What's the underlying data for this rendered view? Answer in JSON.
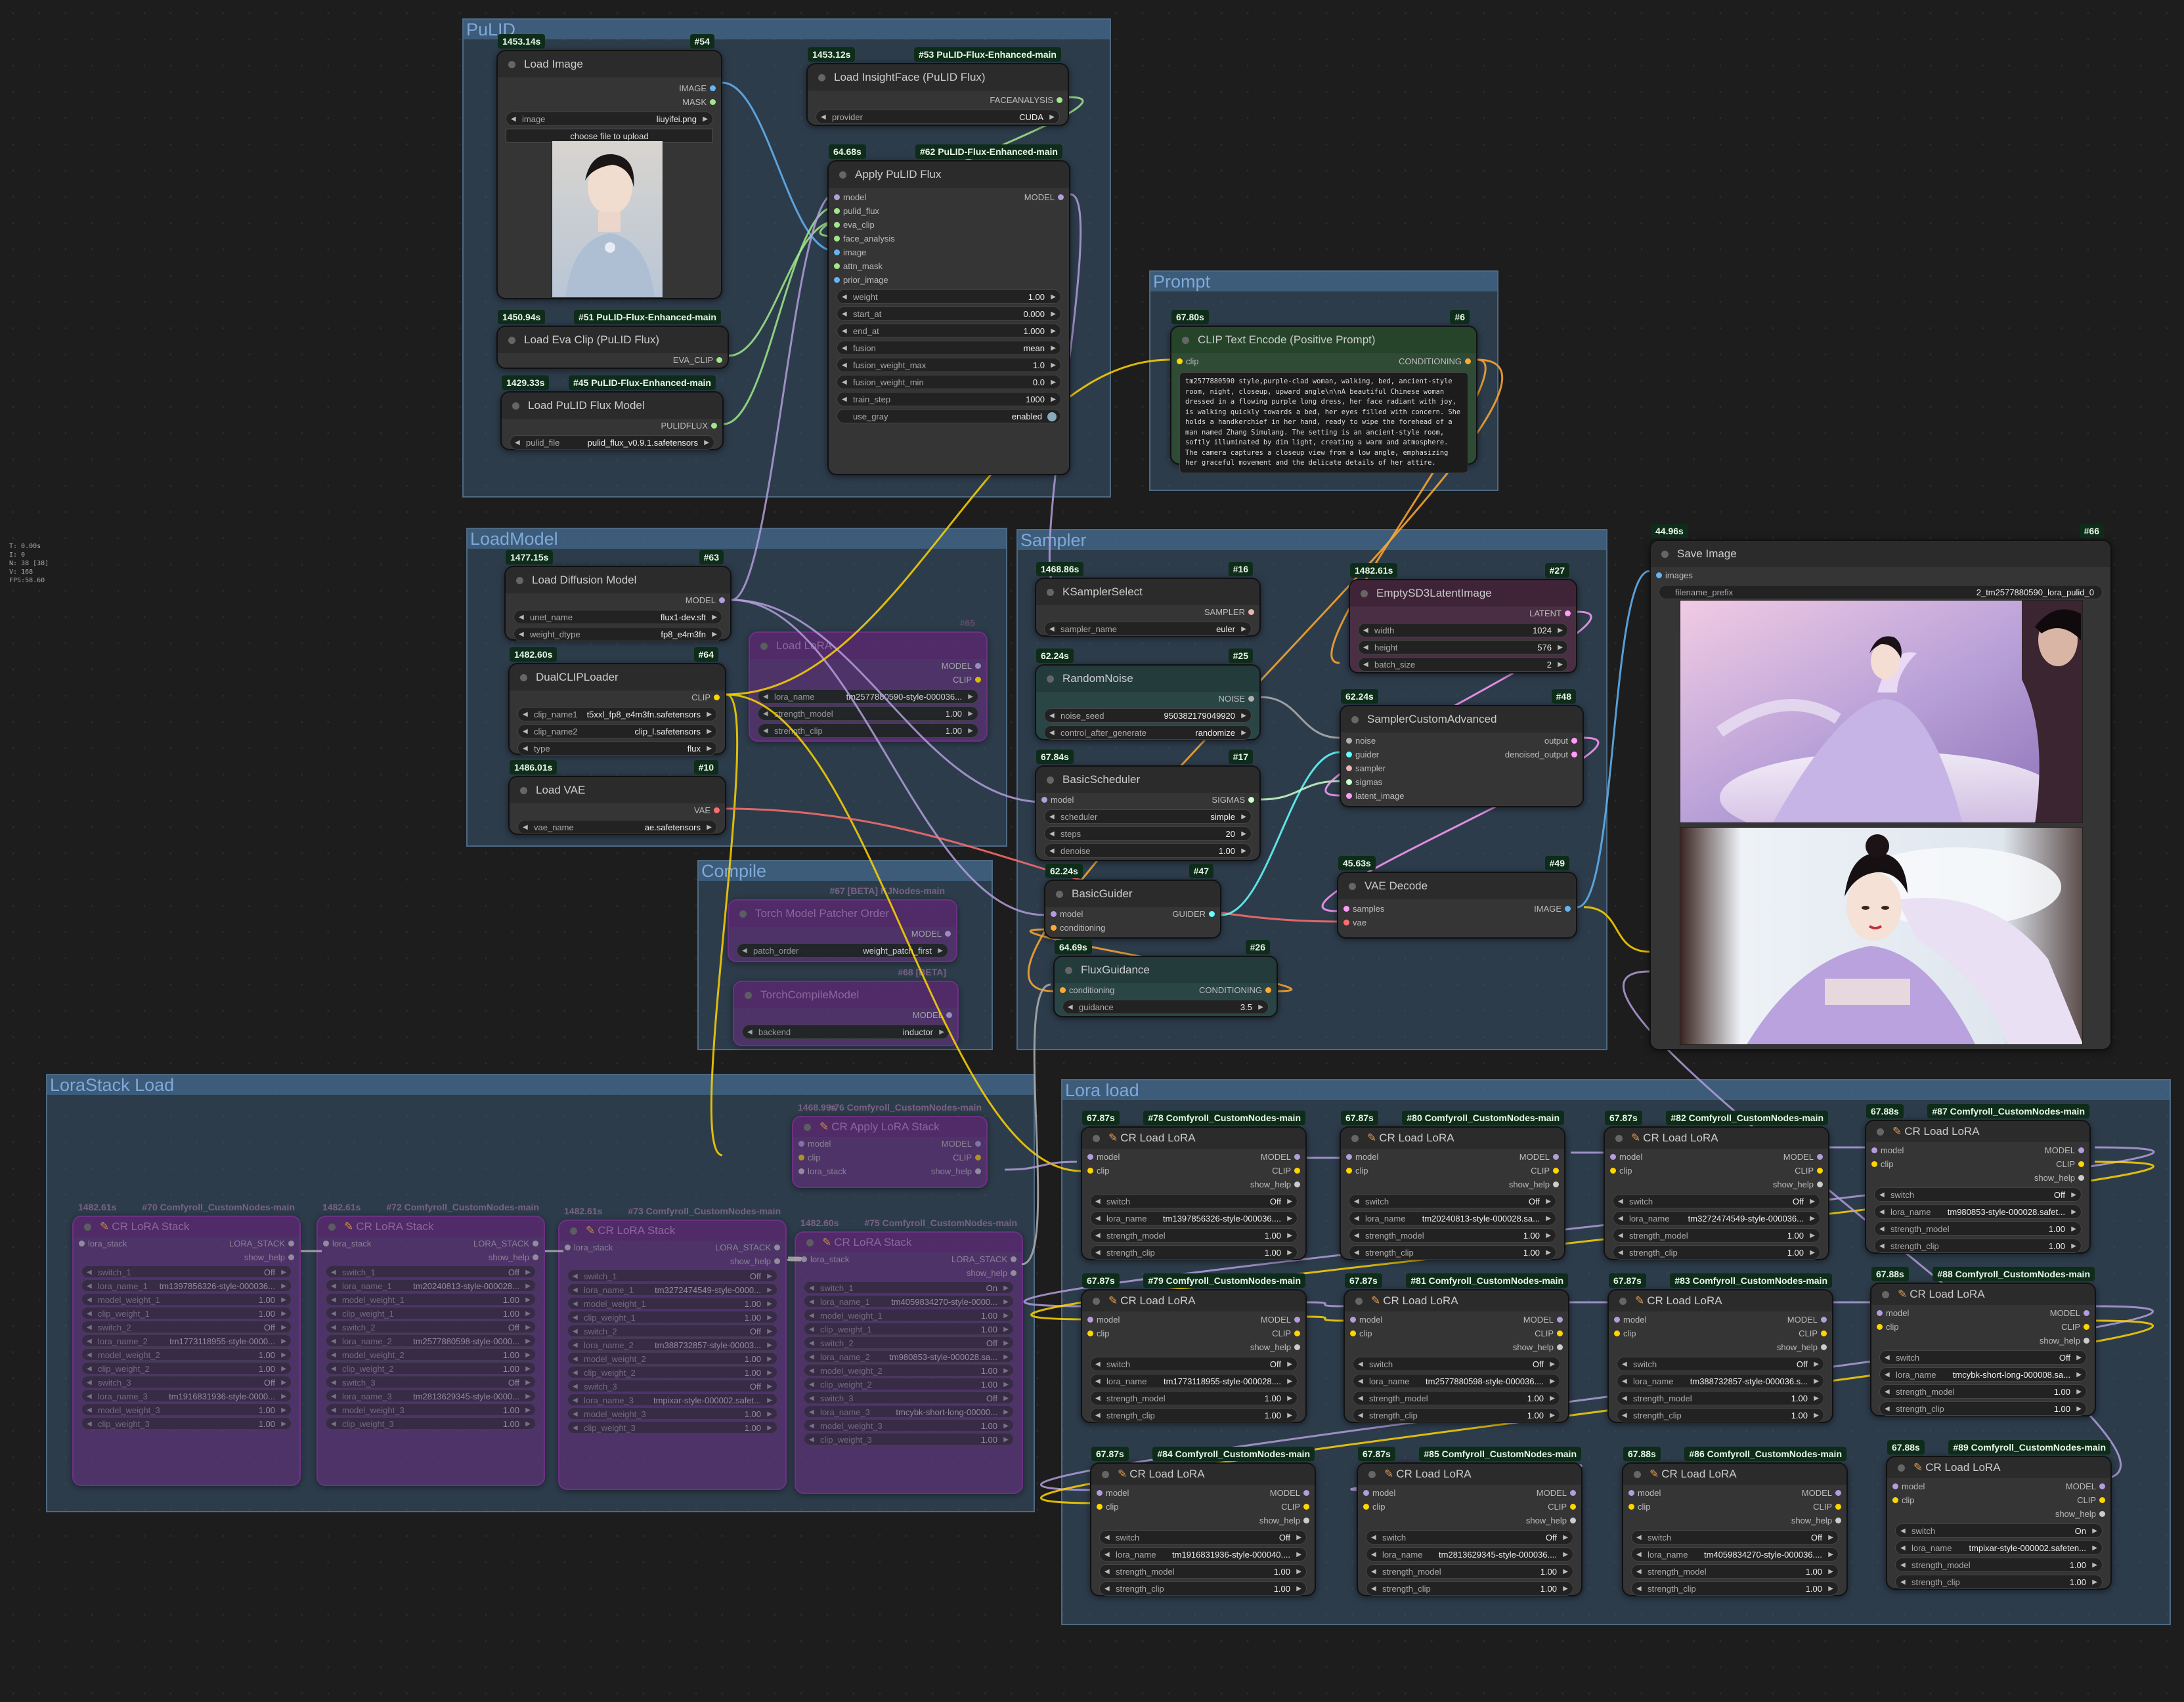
{
  "stats": {
    "line1": "T: 0.00s",
    "line2": "I: 0",
    "line3": "N: 38 [38]",
    "line4": "V: 168",
    "line5": "FPS:58.60"
  },
  "groups": {
    "pulid": "PuLID",
    "prompt": "Prompt",
    "loadmodel": "LoadModel",
    "sampler": "Sampler",
    "compile": "Compile",
    "lorastack": "LoraStack Load",
    "loraload": "Lora load"
  },
  "nodes": {
    "load_image": {
      "time": "1453.14s",
      "id": "#54",
      "title": "Load Image",
      "out1": "IMAGE",
      "out2": "MASK",
      "w_image_label": "image",
      "w_image_value": "liuyifei.png",
      "upload": "choose file to upload"
    },
    "insightface": {
      "time": "1453.12s",
      "id": "#53 PuLID-Flux-Enhanced-main",
      "title": "Load InsightFace (PuLID Flux)",
      "out1": "FACEANALYSIS",
      "w_label": "provider",
      "w_value": "CUDA"
    },
    "apply_pulid": {
      "time": "64.68s",
      "id": "#62 PuLID-Flux-Enhanced-main",
      "title": "Apply PuLID Flux",
      "in": [
        "model",
        "pulid_flux",
        "eva_clip",
        "face_analysis",
        "image",
        "attn_mask",
        "prior_image"
      ],
      "out1": "MODEL",
      "widgets": [
        [
          "weight",
          "1.00"
        ],
        [
          "start_at",
          "0.000"
        ],
        [
          "end_at",
          "1.000"
        ],
        [
          "fusion",
          "mean"
        ],
        [
          "fusion_weight_max",
          "1.0"
        ],
        [
          "fusion_weight_min",
          "0.0"
        ],
        [
          "train_step",
          "1000"
        ]
      ],
      "toggle_label": "use_gray",
      "toggle_value": "enabled"
    },
    "eva_clip": {
      "time": "1450.94s",
      "id": "#51 PuLID-Flux-Enhanced-main",
      "title": "Load Eva Clip (PuLID Flux)",
      "out1": "EVA_CLIP"
    },
    "pulid_model": {
      "time": "1429.33s",
      "id": "#45 PuLID-Flux-Enhanced-main",
      "title": "Load PuLID Flux Model",
      "out1": "PULIDFLUX",
      "w_label": "pulid_file",
      "w_value": "pulid_flux_v0.9.1.safetensors"
    },
    "clip_text": {
      "time": "67.80s",
      "id": "#6",
      "title": "CLIP Text Encode (Positive Prompt)",
      "in1": "clip",
      "out1": "CONDITIONING",
      "text": "tm2577880590 style,purple-clad woman, walking, bed, ancient-style room, night, closeup, upward angle\\n\\nA beautiful Chinese woman dressed in a flowing purple long dress, her face radiant with joy, is walking quickly towards a bed, her eyes filled with concern. She holds a handkerchief in her hand, ready to wipe the forehead of a man named Zhang Simulang. The setting is an ancient-style room, softly illuminated by dim light, creating a warm and atmosphere. The camera captures a closeup view from a low angle, emphasizing her graceful movement and the delicate details of her attire."
    },
    "load_diffusion": {
      "time": "1477.15s",
      "id": "#63",
      "title": "Load Diffusion Model",
      "out1": "MODEL",
      "widgets": [
        [
          "unet_name",
          "flux1-dev.sft"
        ],
        [
          "weight_dtype",
          "fp8_e4m3fn"
        ]
      ]
    },
    "dualclip": {
      "time": "1482.60s",
      "id": "#64",
      "title": "DualCLIPLoader",
      "out1": "CLIP",
      "widgets": [
        [
          "clip_name1",
          "t5xxl_fp8_e4m3fn.safetensors"
        ],
        [
          "clip_name2",
          "clip_l.safetensors"
        ],
        [
          "type",
          "flux"
        ]
      ]
    },
    "load_vae": {
      "time": "1486.01s",
      "id": "#10",
      "title": "Load VAE",
      "out1": "VAE",
      "widgets": [
        [
          "vae_name",
          "ae.safetensors"
        ]
      ]
    },
    "load_lora_bypass": {
      "id": "#65",
      "title": "Load LoRA",
      "out1": "MODEL",
      "out2": "CLIP",
      "widgets": [
        [
          "lora_name",
          "tm2577880590-style-000036..."
        ],
        [
          "strength_model",
          "1.00"
        ],
        [
          "strength_clip",
          "1.00"
        ]
      ]
    },
    "ksampler_select": {
      "time": "1468.86s",
      "id": "#16",
      "title": "KSamplerSelect",
      "out1": "SAMPLER",
      "widgets": [
        [
          "sampler_name",
          "euler"
        ]
      ]
    },
    "random_noise": {
      "time": "62.24s",
      "id": "#25",
      "title": "RandomNoise",
      "out1": "NOISE",
      "widgets": [
        [
          "noise_seed",
          "950382179049920"
        ],
        [
          "control_after_generate",
          "randomize"
        ]
      ]
    },
    "basic_scheduler": {
      "time": "67.84s",
      "id": "#17",
      "title": "BasicScheduler",
      "in1": "model",
      "out1": "SIGMAS",
      "widgets": [
        [
          "scheduler",
          "simple"
        ],
        [
          "steps",
          "20"
        ],
        [
          "denoise",
          "1.00"
        ]
      ]
    },
    "basic_guider": {
      "time": "62.24s",
      "id": "#47",
      "title": "BasicGuider",
      "in1": "model",
      "in2": "conditioning",
      "out1": "GUIDER"
    },
    "flux_guidance": {
      "time": "64.69s",
      "id": "#26",
      "title": "FluxGuidance",
      "in1": "conditioning",
      "out1": "CONDITIONING",
      "widgets": [
        [
          "guidance",
          "3.5"
        ]
      ]
    },
    "empty_latent": {
      "time": "1482.61s",
      "id": "#27",
      "title": "EmptySD3LatentImage",
      "out1": "LATENT",
      "widgets": [
        [
          "width",
          "1024"
        ],
        [
          "height",
          "576"
        ],
        [
          "batch_size",
          "2"
        ]
      ]
    },
    "sampler_custom": {
      "time": "62.24s",
      "id": "#48",
      "title": "SamplerCustomAdvanced",
      "in": [
        "noise",
        "guider",
        "sampler",
        "sigmas",
        "latent_image"
      ],
      "out1": "output",
      "out2": "denoised_output"
    },
    "vae_decode": {
      "time": "45.63s",
      "id": "#49",
      "title": "VAE Decode",
      "in1": "samples",
      "in2": "vae",
      "out1": "IMAGE"
    },
    "save_image": {
      "time": "44.96s",
      "id": "#66",
      "title": "Save Image",
      "in1": "images",
      "w_label": "filename_prefix",
      "w_value": "2_tm2577880590_lora_pulid_0"
    },
    "compile_patch": {
      "id": "#67 [BETA] KJNodes-main",
      "title": "Torch Model Patcher Order",
      "out1": "MODEL",
      "widgets": [
        [
          "patch_order",
          "weight_patch_first"
        ]
      ]
    },
    "compile_torch": {
      "id": "#68 [BETA]",
      "title": "TorchCompileModel",
      "out1": "MODEL",
      "widgets": [
        [
          "backend",
          "inductor"
        ]
      ]
    },
    "cr_apply_stack": {
      "time": "1468.99s",
      "id": "#76 Comfyroll_CustomNodes-main",
      "title": "CR Apply LoRA Stack",
      "in": [
        "model",
        "clip",
        "lora_stack"
      ],
      "out1": "MODEL",
      "out2": "CLIP",
      "hint": "show_help"
    },
    "stacks": [
      {
        "time": "1482.61s",
        "id": "#70 Comfyroll_CustomNodes-main",
        "title": "CR LoRA Stack",
        "in": "lora_stack",
        "out": "LORA_STACK",
        "hint": "show_help",
        "widgets": [
          [
            "switch_1",
            "Off"
          ],
          [
            "lora_name_1",
            "tm1397856326-style-000036..."
          ],
          [
            "model_weight_1",
            "1.00"
          ],
          [
            "clip_weight_1",
            "1.00"
          ],
          [
            "switch_2",
            "Off"
          ],
          [
            "lora_name_2",
            "tm1773118955-style-0000..."
          ],
          [
            "model_weight_2",
            "1.00"
          ],
          [
            "clip_weight_2",
            "1.00"
          ],
          [
            "switch_3",
            "Off"
          ],
          [
            "lora_name_3",
            "tm1916831936-style-0000..."
          ],
          [
            "model_weight_3",
            "1.00"
          ],
          [
            "clip_weight_3",
            "1.00"
          ]
        ]
      },
      {
        "time": "1482.61s",
        "id": "#72 Comfyroll_CustomNodes-main",
        "title": "CR LoRA Stack",
        "in": "lora_stack",
        "out": "LORA_STACK",
        "hint": "show_help",
        "widgets": [
          [
            "switch_1",
            "Off"
          ],
          [
            "lora_name_1",
            "tm20240813-style-000028..."
          ],
          [
            "model_weight_1",
            "1.00"
          ],
          [
            "clip_weight_1",
            "1.00"
          ],
          [
            "switch_2",
            "Off"
          ],
          [
            "lora_name_2",
            "tm2577880598-style-0000..."
          ],
          [
            "model_weight_2",
            "1.00"
          ],
          [
            "clip_weight_2",
            "1.00"
          ],
          [
            "switch_3",
            "Off"
          ],
          [
            "lora_name_3",
            "tm2813629345-style-0000..."
          ],
          [
            "model_weight_3",
            "1.00"
          ],
          [
            "clip_weight_3",
            "1.00"
          ]
        ]
      },
      {
        "time": "1482.61s",
        "id": "#73 Comfyroll_CustomNodes-main",
        "title": "CR LoRA Stack",
        "in": "lora_stack",
        "out": "LORA_STACK",
        "hint": "show_help",
        "widgets": [
          [
            "switch_1",
            "Off"
          ],
          [
            "lora_name_1",
            "tm3272474549-style-0000..."
          ],
          [
            "model_weight_1",
            "1.00"
          ],
          [
            "clip_weight_1",
            "1.00"
          ],
          [
            "switch_2",
            "Off"
          ],
          [
            "lora_name_2",
            "tm388732857-style-00003..."
          ],
          [
            "model_weight_2",
            "1.00"
          ],
          [
            "clip_weight_2",
            "1.00"
          ],
          [
            "switch_3",
            "Off"
          ],
          [
            "lora_name_3",
            "tmpixar-style-000002.safet..."
          ],
          [
            "model_weight_3",
            "1.00"
          ],
          [
            "clip_weight_3",
            "1.00"
          ]
        ]
      },
      {
        "time": "1482.60s",
        "id": "#75 Comfyroll_CustomNodes-main",
        "title": "CR LoRA Stack",
        "in": "lora_stack",
        "out": "LORA_STACK",
        "hint": "show_help",
        "widgets": [
          [
            "switch_1",
            "On"
          ],
          [
            "lora_name_1",
            "tm4059834270-style-0000..."
          ],
          [
            "model_weight_1",
            "1.00"
          ],
          [
            "clip_weight_1",
            "1.00"
          ],
          [
            "switch_2",
            "Off"
          ],
          [
            "lora_name_2",
            "tm980853-style-000028.sa..."
          ],
          [
            "model_weight_2",
            "1.00"
          ],
          [
            "clip_weight_2",
            "1.00"
          ],
          [
            "switch_3",
            "Off"
          ],
          [
            "lora_name_3",
            "tmcybk-short-long-00000..."
          ],
          [
            "model_weight_3",
            "1.00"
          ],
          [
            "clip_weight_3",
            "1.00"
          ]
        ]
      }
    ],
    "cr_loras": [
      {
        "time": "67.87s",
        "id": "#78 Comfyroll_CustomNodes-main",
        "title": "CR Load LoRA",
        "switch": "Off",
        "lora": "tm1397856326-style-000036....",
        "sm": "1.00",
        "sc": "1.00"
      },
      {
        "time": "67.87s",
        "id": "#80 Comfyroll_CustomNodes-main",
        "title": "CR Load LoRA",
        "switch": "Off",
        "lora": "tm20240813-style-000028.sa...",
        "sm": "1.00",
        "sc": "1.00"
      },
      {
        "time": "67.87s",
        "id": "#82 Comfyroll_CustomNodes-main",
        "title": "CR Load LoRA",
        "switch": "Off",
        "lora": "tm3272474549-style-000036...",
        "sm": "1.00",
        "sc": "1.00"
      },
      {
        "time": "67.88s",
        "id": "#87 Comfyroll_CustomNodes-main",
        "title": "CR Load LoRA",
        "switch": "Off",
        "lora": "tm980853-style-000028.safet...",
        "sm": "1.00",
        "sc": "1.00"
      },
      {
        "time": "67.87s",
        "id": "#79 Comfyroll_CustomNodes-main",
        "title": "CR Load LoRA",
        "switch": "Off",
        "lora": "tm1773118955-style-000028....",
        "sm": "1.00",
        "sc": "1.00"
      },
      {
        "time": "67.87s",
        "id": "#81 Comfyroll_CustomNodes-main",
        "title": "CR Load LoRA",
        "switch": "Off",
        "lora": "tm2577880598-style-000036....",
        "sm": "1.00",
        "sc": "1.00"
      },
      {
        "time": "67.87s",
        "id": "#83 Comfyroll_CustomNodes-main",
        "title": "CR Load LoRA",
        "switch": "Off",
        "lora": "tm388732857-style-000036.s...",
        "sm": "1.00",
        "sc": "1.00"
      },
      {
        "time": "67.88s",
        "id": "#88 Comfyroll_CustomNodes-main",
        "title": "CR Load LoRA",
        "switch": "Off",
        "lora": "tmcybk-short-long-000008.sa...",
        "sm": "1.00",
        "sc": "1.00"
      },
      {
        "time": "67.87s",
        "id": "#84 Comfyroll_CustomNodes-main",
        "title": "CR Load LoRA",
        "switch": "Off",
        "lora": "tm1916831936-style-000040....",
        "sm": "1.00",
        "sc": "1.00"
      },
      {
        "time": "67.87s",
        "id": "#85 Comfyroll_CustomNodes-main",
        "title": "CR Load LoRA",
        "switch": "Off",
        "lora": "tm2813629345-style-000036....",
        "sm": "1.00",
        "sc": "1.00"
      },
      {
        "time": "67.88s",
        "id": "#86 Comfyroll_CustomNodes-main",
        "title": "CR Load LoRA",
        "switch": "Off",
        "lora": "tm4059834270-style-000036....",
        "sm": "1.00",
        "sc": "1.00"
      },
      {
        "time": "67.88s",
        "id": "#89 Comfyroll_CustomNodes-main",
        "title": "CR Load LoRA",
        "switch": "On",
        "lora": "tmpixar-style-000002.safeten...",
        "sm": "1.00",
        "sc": "1.00"
      }
    ],
    "cr_lora_labels": {
      "model": "model",
      "clip": "clip",
      "out_model": "MODEL",
      "out_clip": "CLIP",
      "hint": "show_help",
      "switch": "switch",
      "lora_name": "lora_name",
      "strength_model": "strength_model",
      "strength_clip": "strength_clip"
    }
  },
  "colors": {
    "model": "#b39ddb",
    "clip": "#ffd500",
    "vae": "#ff6e6e",
    "image": "#64b5f6",
    "latent": "#ff9cf9",
    "conditioning": "#ffa931",
    "noise": "#b0b0b0",
    "sigmas": "#cdffcd",
    "guider": "#66ffff",
    "eva": "#a1e78a"
  }
}
